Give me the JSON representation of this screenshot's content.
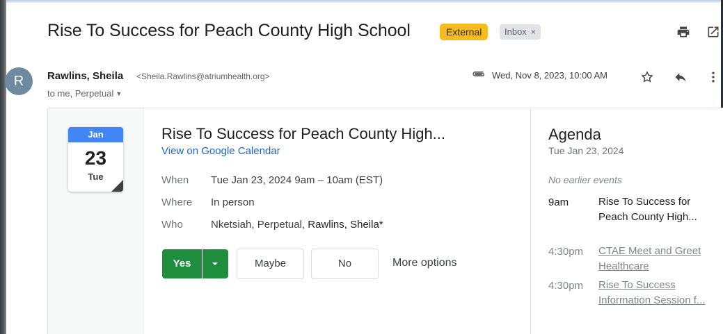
{
  "email": {
    "subject": "Rise To Success for Peach County High School",
    "labels": {
      "external": "External",
      "inbox": "Inbox"
    },
    "sender": {
      "avatar_letter": "R",
      "name": "Rawlins, Sheila",
      "email": "<Sheila.Rawlins@atriumhealth.org>"
    },
    "recipients": "to me, Perpetual",
    "date": "Wed, Nov 8, 2023, 10:00 AM"
  },
  "invite": {
    "calendar_icon": {
      "month": "Jan",
      "day": "23",
      "weekday": "Tue"
    },
    "title": "Rise To Success for Peach County High...",
    "calendar_link": "View on Google Calendar",
    "details": {
      "when_label": "When",
      "when_value": "Tue Jan 23, 2024 9am – 10am (EST)",
      "where_label": "Where",
      "where_value": "In person",
      "who_label": "Who",
      "who_value_plain": "Nketsiah, Perpetual, ",
      "who_value_strong": "Rawlins, Sheila*"
    },
    "rsvp": {
      "yes": "Yes",
      "maybe": "Maybe",
      "no": "No",
      "more": "More options"
    }
  },
  "agenda": {
    "title": "Agenda",
    "date": "Tue Jan 23, 2024",
    "empty_note": "No earlier events",
    "events": [
      {
        "time": "9am",
        "title": "Rise To Success for Peach County High..."
      },
      {
        "time": "4:30pm",
        "title": "CTAE Meet and Greet Healthcare"
      },
      {
        "time": "4:30pm",
        "title": "Rise To Success Information Session f..."
      }
    ]
  },
  "colors": {
    "external_badge": "#f6bb1e",
    "rsvp_yes": "#1e8e3e",
    "link": "#1a67d2",
    "calendar_header": "#4285f4"
  },
  "icons": [
    "print-icon",
    "open-in-new-icon",
    "attachment-icon",
    "star-icon",
    "reply-icon",
    "more-vert-icon",
    "calendar-icon"
  ]
}
